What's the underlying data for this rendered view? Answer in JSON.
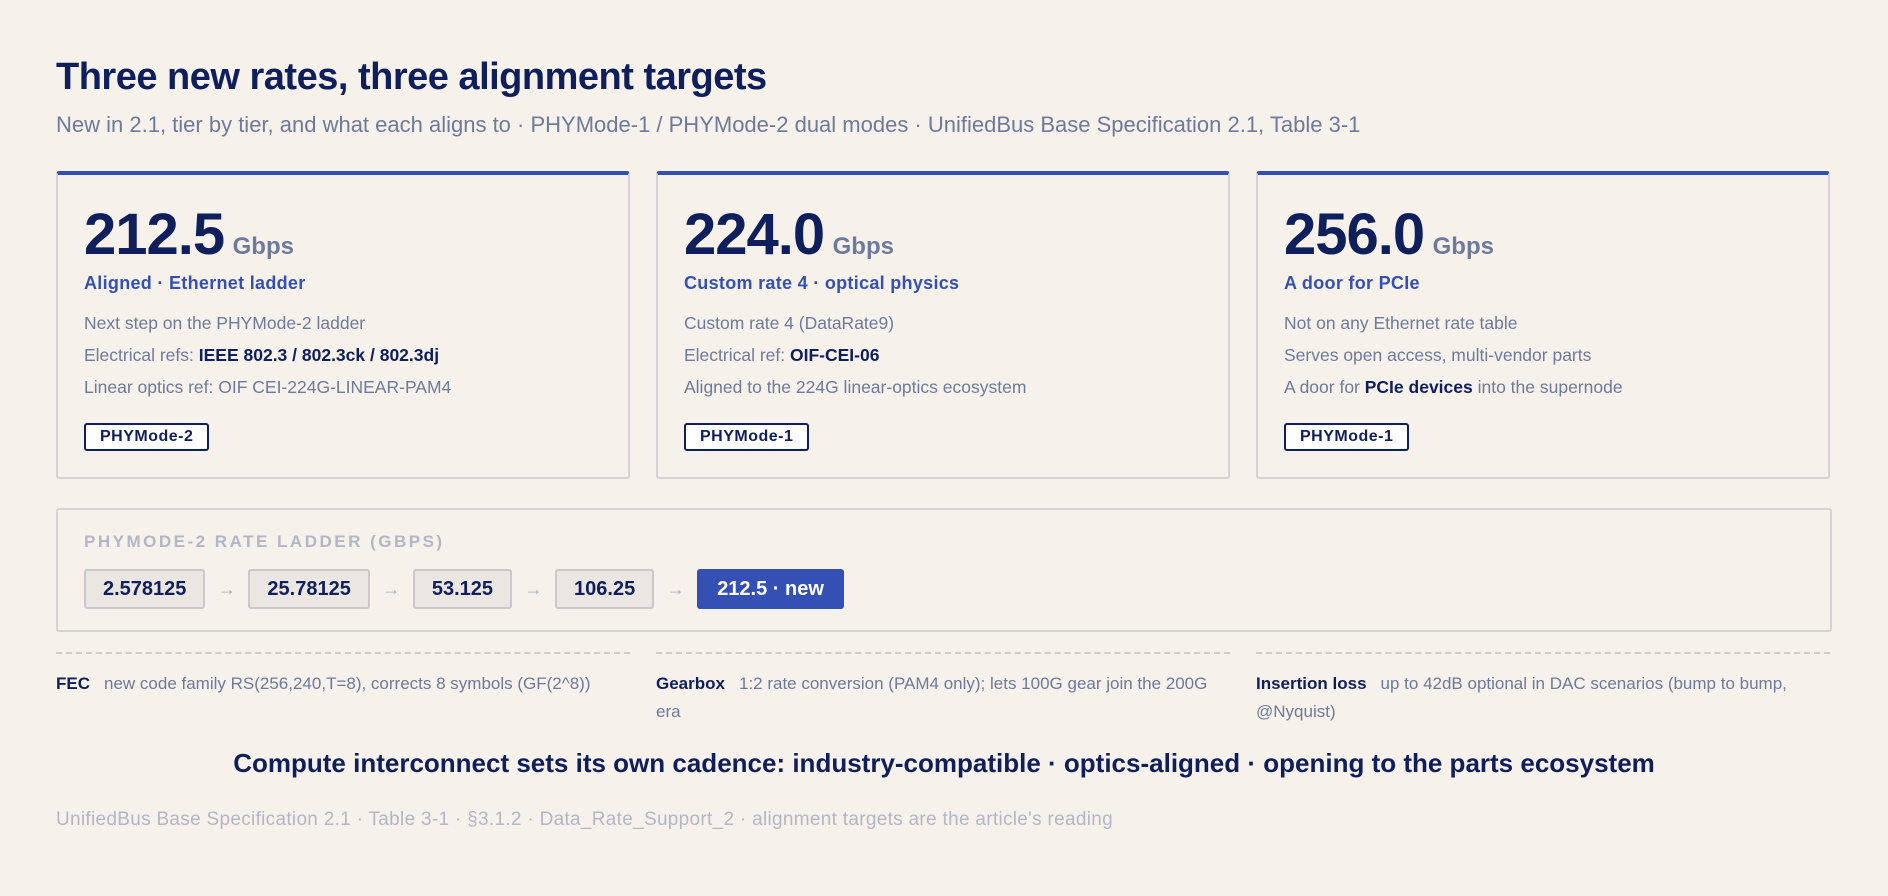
{
  "header": {
    "title": "Three new rates, three alignment targets",
    "subtitle": "New in 2.1, tier by tier, and what each aligns to · PHYMode-1 / PHYMode-2 dual modes · UnifiedBus Base Specification 2.1, Table 3-1"
  },
  "cards": [
    {
      "rate": "212.5",
      "unit": "Gbps",
      "tag": "Aligned · Ethernet ladder",
      "line1": "Next step on the PHYMode-2 ladder",
      "line2_prefix": "Electrical refs: ",
      "line2_bold": "IEEE 802.3 / 802.3ck / 802.3dj",
      "line3": "Linear optics ref: OIF CEI-224G-LINEAR-PAM4",
      "mode": "PHYMode-2"
    },
    {
      "rate": "224.0",
      "unit": "Gbps",
      "tag": "Custom rate 4 · optical physics",
      "line1": "Custom rate 4 (DataRate9)",
      "line2_prefix": "Electrical ref: ",
      "line2_bold": "OIF-CEI-06",
      "line3": "Aligned to the 224G linear-optics ecosystem",
      "mode": "PHYMode-1"
    },
    {
      "rate": "256.0",
      "unit": "Gbps",
      "tag": "A door for PCIe",
      "line1": "Not on any Ethernet rate table",
      "line2": "Serves open access, multi-vendor parts",
      "line3_prefix": "A door for ",
      "line3_bold": "PCIe devices",
      "line3_suffix": " into the supernode",
      "mode": "PHYMode-1"
    }
  ],
  "ladder": {
    "title": "PHYMODE-2 RATE LADDER (GBPS)",
    "steps": [
      "2.578125",
      "25.78125",
      "53.125",
      "106.25",
      "212.5 · new"
    ],
    "arrow": "→"
  },
  "notes": [
    {
      "label": "FEC",
      "text": "new code family RS(256,240,T=8), corrects 8 symbols (GF(2^8))"
    },
    {
      "label": "Gearbox",
      "text": "1:2 rate conversion (PAM4 only); lets 100G gear join the 200G era"
    },
    {
      "label": "Insertion loss",
      "text": "up to 42dB optional in DAC scenarios (bump to bump, @Nyquist)"
    }
  ],
  "tagline": "Compute interconnect sets its own cadence: industry-compatible · optics-aligned · opening to the parts ecosystem",
  "footer": "UnifiedBus Base Specification 2.1 · Table 3-1 · §3.1.2 · Data_Rate_Support_2 · alignment targets are the article's reading",
  "colors": {
    "background": "#f6f1eb",
    "navy": "#0f1f5c",
    "accent": "#3450b5",
    "muted": "#6e7a9a",
    "faint": "#b3b6c4"
  }
}
